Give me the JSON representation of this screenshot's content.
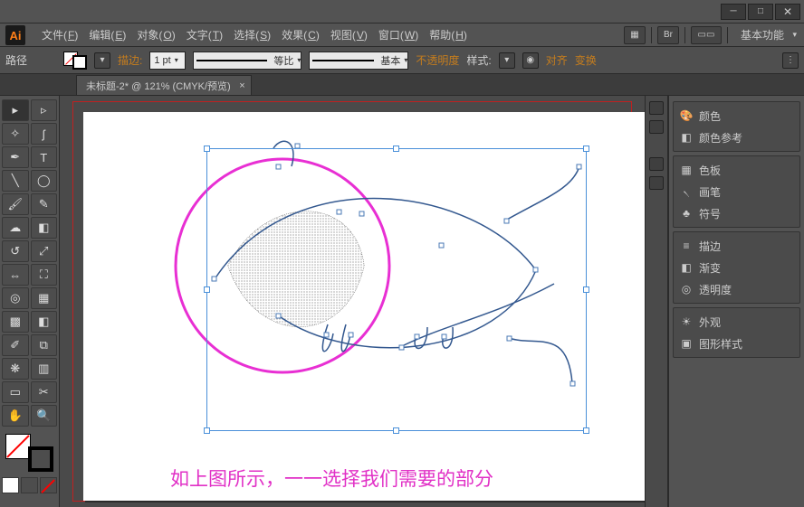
{
  "window": {
    "logo": "Ai",
    "minimize": "─",
    "maximize": "□",
    "close": "✕"
  },
  "menu": {
    "items": [
      {
        "label": "文件",
        "key": "F"
      },
      {
        "label": "编辑",
        "key": "E"
      },
      {
        "label": "对象",
        "key": "O"
      },
      {
        "label": "文字",
        "key": "T"
      },
      {
        "label": "选择",
        "key": "S"
      },
      {
        "label": "效果",
        "key": "C"
      },
      {
        "label": "视图",
        "key": "V"
      },
      {
        "label": "窗口",
        "key": "W"
      },
      {
        "label": "帮助",
        "key": "H"
      }
    ],
    "right_icons": [
      "▦",
      "Br",
      "▭▭"
    ],
    "workspace": "基本功能"
  },
  "control": {
    "context": "路径",
    "stroke_label": "描边:",
    "stroke_value": "1 pt",
    "profile": "等比",
    "brush": "基本",
    "opacity_label": "不透明度",
    "style_label": "样式:",
    "align_label": "对齐",
    "transform_label": "变换"
  },
  "document": {
    "tab_label": "未标题-2* @ 121% (CMYK/预览)",
    "close": "×",
    "caption": "如上图所示，一一选择我们需要的部分"
  },
  "panels": {
    "group1": [
      {
        "icon": "🎨",
        "label": "颜色"
      },
      {
        "icon": "◧",
        "label": "颜色参考"
      }
    ],
    "group2": [
      {
        "icon": "▦",
        "label": "色板"
      },
      {
        "icon": "৲",
        "label": "画笔"
      },
      {
        "icon": "♣",
        "label": "符号"
      }
    ],
    "group3": [
      {
        "icon": "≡",
        "label": "描边"
      },
      {
        "icon": "◧",
        "label": "渐变"
      },
      {
        "icon": "◎",
        "label": "透明度"
      }
    ],
    "group4": [
      {
        "icon": "☀",
        "label": "外观"
      },
      {
        "icon": "▣",
        "label": "图形样式"
      }
    ]
  }
}
